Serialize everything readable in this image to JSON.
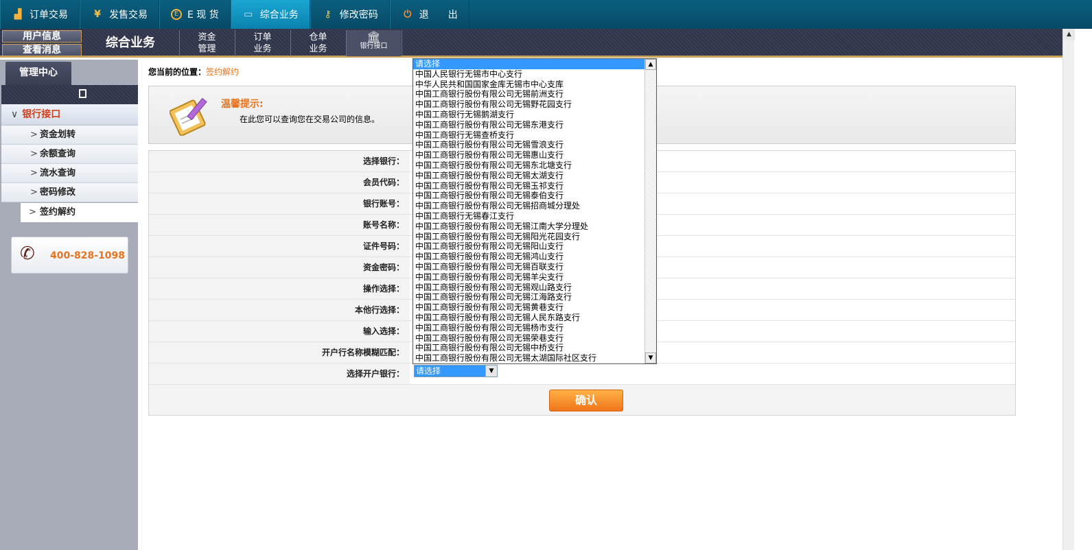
{
  "topnav": {
    "tabs": [
      {
        "label": "订单交易",
        "icon": "chart-icon"
      },
      {
        "label": "发售交易",
        "icon": "yen-icon"
      },
      {
        "label": "E 现 货",
        "icon": "e-coin-icon"
      },
      {
        "label": "综合业务",
        "icon": "monitor-icon",
        "active": true
      },
      {
        "label": "修改密码",
        "icon": "key-icon"
      },
      {
        "label": "退　　出",
        "icon": "power-icon"
      }
    ]
  },
  "subbar": {
    "user_info": "用户信息",
    "view_messages": "查看消息",
    "title": "综合业务",
    "items": [
      {
        "line1": "资金",
        "line2": "管理"
      },
      {
        "line1": "订单",
        "line2": "业务"
      },
      {
        "line1": "仓单",
        "line2": "业务"
      },
      {
        "line1": "",
        "line2": "银行接口",
        "icon": "bank-icon"
      }
    ]
  },
  "sidebar": {
    "tab": "管理中心",
    "group": "银行接口",
    "items": [
      "资金划转",
      "余额查询",
      "流水查询",
      "密码修改",
      "签约解约"
    ],
    "selected": "签约解约",
    "phone": "400-828-1098"
  },
  "breadcrumb": {
    "label": "您当前的位置：",
    "current": "签约解约"
  },
  "tip": {
    "title": "温馨提示:",
    "text": "在此您可以查询您在交易公司的信息。"
  },
  "form": {
    "fields": [
      "选择银行：",
      "会员代码：",
      "银行账号：",
      "账号名称：",
      "证件号码：",
      "资金密码：",
      "操作选择：",
      "本他行选择：",
      "输入选择：",
      "开户行名称模糊匹配：",
      "选择开户银行："
    ],
    "bank_select_value": "请选择",
    "submit": "确认"
  },
  "dropdown": {
    "options": [
      "请选择",
      "中国人民银行无锡市中心支行",
      "中华人民共和国国家金库无锡市中心支库",
      "中国工商银行股份有限公司无锡前洲支行",
      "中国工商银行股份有限公司无锡野花园支行",
      "中国工商银行无锡鹅湖支行",
      "中国工商银行股份有限公司无锡东港支行",
      "中国工商银行无锡查桥支行",
      "中国工商银行股份有限公司无锡雪浪支行",
      "中国工商银行股份有限公司无锡惠山支行",
      "中国工商银行股份有限公司无锡东北塘支行",
      "中国工商银行股份有限公司无锡太湖支行",
      "中国工商银行股份有限公司无锡玉祁支行",
      "中国工商银行股份有限公司无锡泰伯支行",
      "中国工商银行股份有限公司无锡招商城分理处",
      "中国工商银行无锡春江支行",
      "中国工商银行股份有限公司无锡江南大学分理处",
      "中国工商银行股份有限公司无锡阳光花园支行",
      "中国工商银行股份有限公司无锡阳山支行",
      "中国工商银行股份有限公司无锡鸿山支行",
      "中国工商银行股份有限公司无锡百联支行",
      "中国工商银行股份有限公司无锡羊尖支行",
      "中国工商银行股份有限公司无锡观山路支行",
      "中国工商银行股份有限公司无锡江海路支行",
      "中国工商银行股份有限公司无锡黄巷支行",
      "中国工商银行股份有限公司无锡人民东路支行",
      "中国工商银行股份有限公司无锡杨市支行",
      "中国工商银行股份有限公司无锡荣巷支行",
      "中国工商银行股份有限公司无锡中桥支行",
      "中国工商银行股份有限公司无锡太湖国际社区支行"
    ]
  }
}
